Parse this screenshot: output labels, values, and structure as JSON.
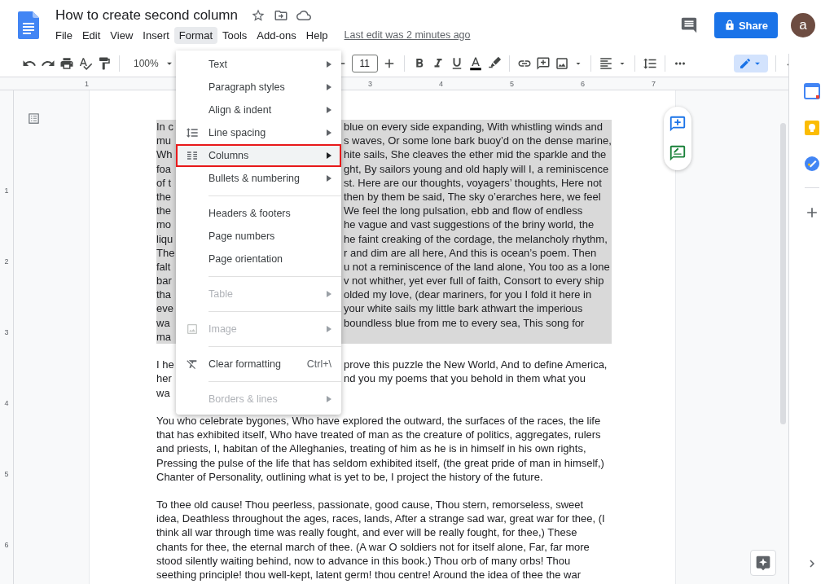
{
  "document": {
    "title": "How to create second column"
  },
  "menu_bar": [
    {
      "label": "File",
      "selected": false
    },
    {
      "label": "Edit",
      "selected": false
    },
    {
      "label": "View",
      "selected": false
    },
    {
      "label": "Insert",
      "selected": false
    },
    {
      "label": "Format",
      "selected": true
    },
    {
      "label": "Tools",
      "selected": false
    },
    {
      "label": "Add-ons",
      "selected": false
    },
    {
      "label": "Help",
      "selected": false
    }
  ],
  "last_edit": "Last edit was 2 minutes ago",
  "share_button": "Share",
  "avatar": "a",
  "toolbar": {
    "zoom": "100%",
    "font_size": "11"
  },
  "ruler": {
    "marks": [
      "1",
      "3",
      "4",
      "5",
      "6",
      "7"
    ],
    "vertical_marks": [
      "1",
      "2",
      "3",
      "4",
      "5",
      "6"
    ]
  },
  "format_menu": [
    {
      "kind": "item",
      "label": "Text",
      "submenu": true,
      "disabled": false,
      "selected": false
    },
    {
      "kind": "item",
      "label": "Paragraph styles",
      "submenu": true,
      "disabled": false,
      "selected": false
    },
    {
      "kind": "item",
      "label": "Align & indent",
      "submenu": true,
      "disabled": false,
      "selected": false
    },
    {
      "kind": "item",
      "label": "Line spacing",
      "submenu": true,
      "disabled": false,
      "selected": false
    },
    {
      "kind": "item",
      "label": "Columns",
      "submenu": true,
      "disabled": false,
      "selected": true
    },
    {
      "kind": "item",
      "label": "Bullets & numbering",
      "submenu": true,
      "disabled": false,
      "selected": false
    },
    {
      "kind": "separator"
    },
    {
      "kind": "item",
      "label": "Headers & footers",
      "submenu": false,
      "disabled": false,
      "selected": false
    },
    {
      "kind": "item",
      "label": "Page numbers",
      "submenu": false,
      "disabled": false,
      "selected": false
    },
    {
      "kind": "item",
      "label": "Page orientation",
      "submenu": false,
      "disabled": false,
      "selected": false
    },
    {
      "kind": "separator"
    },
    {
      "kind": "item",
      "label": "Table",
      "submenu": true,
      "disabled": true,
      "selected": false
    },
    {
      "kind": "separator"
    },
    {
      "kind": "item",
      "label": "Image",
      "submenu": true,
      "disabled": true,
      "selected": false
    },
    {
      "kind": "separator"
    },
    {
      "kind": "item",
      "label": "Clear formatting",
      "submenu": false,
      "disabled": false,
      "selected": false,
      "shortcut": "Ctrl+\\"
    },
    {
      "kind": "separator"
    },
    {
      "kind": "item",
      "label": "Borders & lines",
      "submenu": true,
      "disabled": true,
      "selected": false
    }
  ],
  "paragraphs": [
    {
      "selected": true,
      "lines": [
        {
          "kind": "covered",
          "left": "In c",
          "right": "blue on every side expanding, With whistling winds and"
        },
        {
          "kind": "covered",
          "left": "mu",
          "right": "s waves, Or some lone bark buoy’d on the dense marine,"
        },
        {
          "kind": "covered",
          "left": "Wh",
          "right": "hite sails, She cleaves the ether mid the sparkle and the"
        },
        {
          "kind": "covered",
          "left": "foa",
          "right": "ght, By sailors young and old haply will I, a reminiscence"
        },
        {
          "kind": "covered",
          "left": "of t",
          "right": "st. Here are our thoughts, voyagers’ thoughts, Here not"
        },
        {
          "kind": "covered",
          "left": "the",
          "right": "then by them be said, The sky o’erarches here, we feel"
        },
        {
          "kind": "covered",
          "left": "the",
          "right": "We feel the long pulsation, ebb and flow of endless"
        },
        {
          "kind": "covered",
          "left": "mo",
          "right": "he vague and vast suggestions of the briny world, the"
        },
        {
          "kind": "covered",
          "left": "liqu",
          "right": "he faint creaking of the cordage, the melancholy rhythm,"
        },
        {
          "kind": "covered",
          "left": "The",
          "right": "r and dim are all here, And this is ocean’s poem. Then"
        },
        {
          "kind": "covered",
          "left": "falt",
          "right": "u not a reminiscence of the land alone, You too as a lone"
        },
        {
          "kind": "covered",
          "left": "bar",
          "right": "v not whither, yet ever full of faith, Consort to every ship"
        },
        {
          "kind": "covered",
          "left": "tha",
          "right": "olded my love, (dear mariners, for you I fold it here in"
        },
        {
          "kind": "covered",
          "left": "eve",
          "right": "your white sails my little bark athwart the imperious"
        },
        {
          "kind": "covered",
          "left": "wa",
          "right": "boundless blue from me to every sea, This song for"
        },
        {
          "kind": "covered",
          "left": "ma"
        }
      ]
    },
    {
      "selected": false,
      "lines": [
        {
          "kind": "covered",
          "left": "I he",
          "right": "prove this puzzle the New World, And to define America,"
        },
        {
          "kind": "covered",
          "left": "her",
          "right": "nd you my poems that you behold in them what you"
        },
        {
          "kind": "covered",
          "left": "wa"
        }
      ]
    },
    {
      "selected": false,
      "lines": [
        {
          "kind": "full",
          "text": "You who celebrate bygones, Who have explored the outward, the surfaces of the races, the life"
        },
        {
          "kind": "full",
          "text": "that has exhibited itself, Who have treated of man as the creature of politics, aggregates, rulers"
        },
        {
          "kind": "full",
          "text": "and priests, I, habitan of the Alleghanies, treating of him as he is in himself in his own rights,"
        },
        {
          "kind": "full",
          "text": "Pressing the pulse of the life that has seldom exhibited itself, (the great pride of man in himself,)"
        },
        {
          "kind": "full",
          "text": "Chanter of Personality, outlining what is yet to be, I project the history of the future."
        }
      ]
    },
    {
      "selected": false,
      "lines": [
        {
          "kind": "full",
          "text": "To thee old cause! Thou peerless, passionate, good cause, Thou stern, remorseless, sweet"
        },
        {
          "kind": "full",
          "text": "idea, Deathless throughout the ages, races, lands, After a strange sad war, great war for thee, (I"
        },
        {
          "kind": "full",
          "text": "think all war through time was really fought, and ever will be really fought, for thee,) These"
        },
        {
          "kind": "full",
          "text": "chants for thee, the eternal march of thee. (A war O soldiers not for itself alone, Far, far more"
        },
        {
          "kind": "full",
          "text": "stood silently waiting behind, now to advance in this book.) Thou orb of many orbs! Thou"
        },
        {
          "kind": "full",
          "text": "seething principle! thou well-kept, latent germ! thou centre! Around the idea of thee the war"
        }
      ]
    }
  ]
}
